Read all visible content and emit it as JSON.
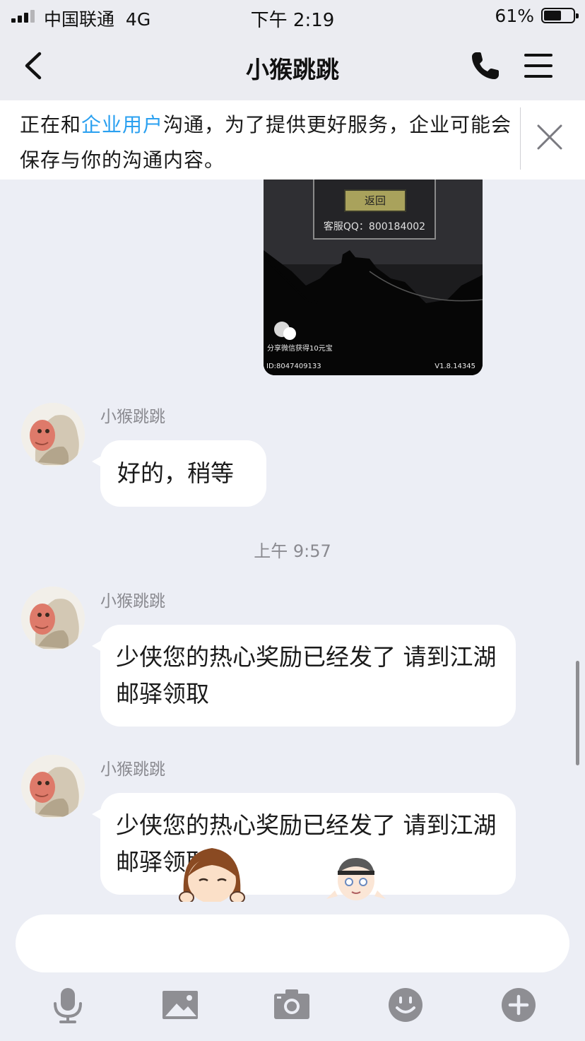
{
  "status_bar": {
    "carrier": "中国联通",
    "network": "4G",
    "time": "下午 2:19",
    "battery_percent": "61%",
    "battery_level": 0.61
  },
  "nav": {
    "title": "小猴跳跳",
    "back_icon": "chevron-left-icon",
    "call_icon": "phone-icon",
    "menu_icon": "hamburger-menu-icon"
  },
  "notice": {
    "prefix": "正在和",
    "link": "企业用户",
    "suffix": "沟通，为了提供更好服务，企业可能会保存与你的沟通内容。",
    "close_icon": "close-icon",
    "link_color": "#2aa0f0"
  },
  "image_message": {
    "button_label": "返回",
    "support_qq": "客服QQ：800184002",
    "share_text": "分享微信获得10元宝",
    "user_id": "ID:8047409133",
    "version": "V1.8.14345"
  },
  "messages": [
    {
      "sender": "小猴跳跳",
      "text": "好的，稍等"
    },
    {
      "sender": "小猴跳跳",
      "text": "少侠您的热心奖励已经发了 请到江湖邮驿领取"
    },
    {
      "sender": "小猴跳跳",
      "text": "少侠您的热心奖励已经发了 请到江湖邮驿领取"
    }
  ],
  "timestamp": "上午 9:57",
  "toolbar": {
    "icons": [
      "microphone-icon",
      "image-icon",
      "camera-icon",
      "emoji-icon",
      "plus-icon"
    ]
  }
}
